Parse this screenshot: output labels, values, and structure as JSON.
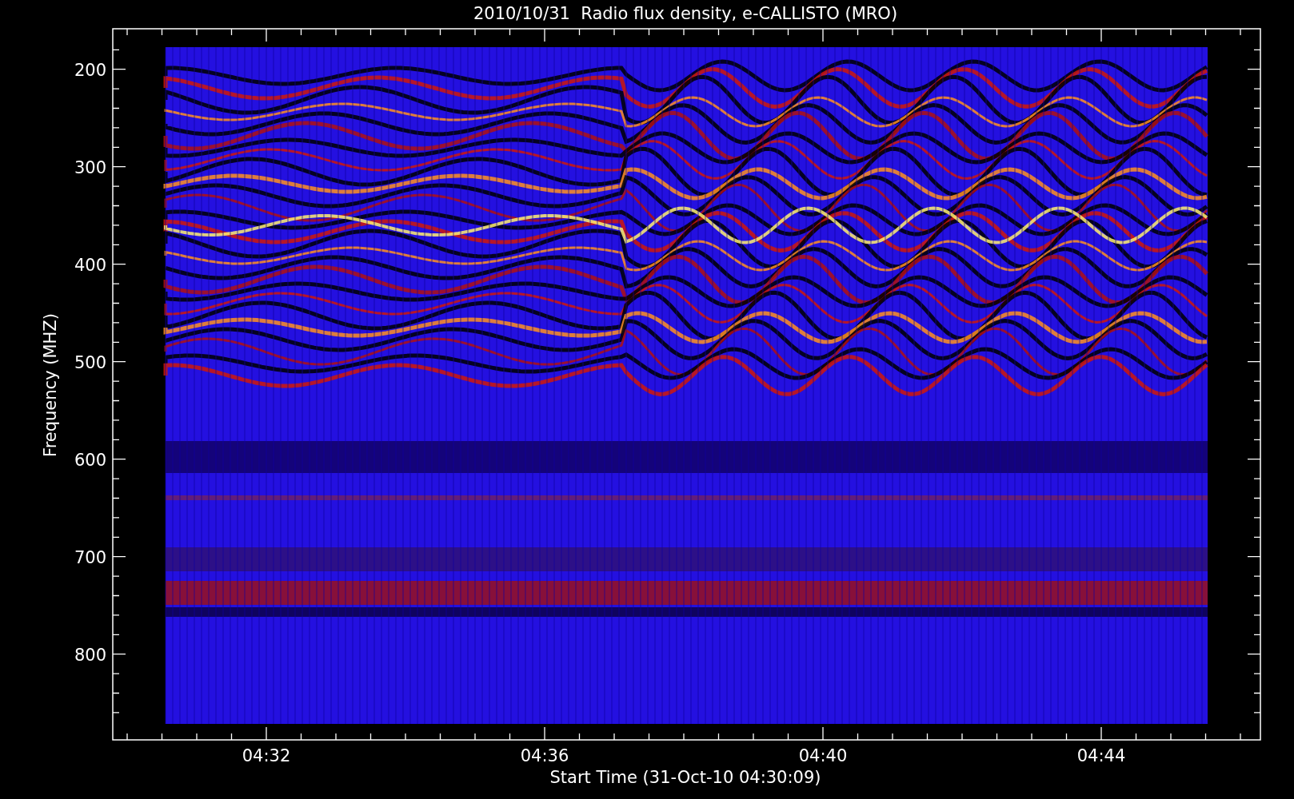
{
  "title": "2010/10/31  Radio flux density, e-CALLISTO (MRO)",
  "y_axis": {
    "label": "Frequency (MHZ)",
    "ticks": [
      "200",
      "300",
      "400",
      "500",
      "600",
      "700",
      "800"
    ]
  },
  "x_axis": {
    "label": "Start Time (31-Oct-10 04:30:09)",
    "ticks": [
      "04:32",
      "04:36",
      "04:40",
      "04:44"
    ]
  }
}
